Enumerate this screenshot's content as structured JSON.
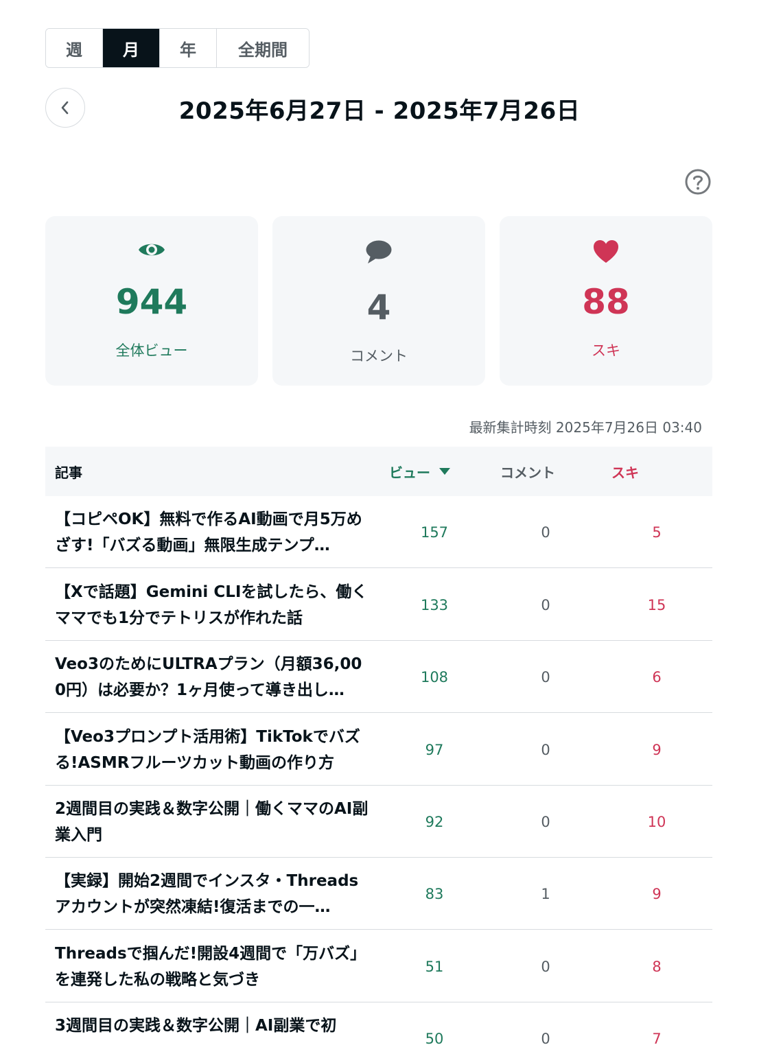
{
  "period_tabs": [
    "週",
    "月",
    "年",
    "全期間"
  ],
  "date_range": "2025年6月27日 - 2025年7月26日",
  "summary": {
    "views": {
      "value": "944",
      "label": "全体ビュー"
    },
    "comments": {
      "value": "4",
      "label": "コメント"
    },
    "likes": {
      "value": "88",
      "label": "スキ"
    }
  },
  "updated_at": "最新集計時刻 2025年7月26日 03:40",
  "table": {
    "headers": {
      "article": "記事",
      "views": "ビュー",
      "comments": "コメント",
      "likes": "スキ"
    },
    "rows": [
      {
        "title": "【コピペOK】無料で作るAI動画で月5万めざす!「バズる動画」無限生成テンプ…",
        "views": "157",
        "comments": "0",
        "likes": "5"
      },
      {
        "title": "【Xで話題】Gemini CLIを試したら、働くママでも1分でテトリスが作れた話",
        "views": "133",
        "comments": "0",
        "likes": "15"
      },
      {
        "title": "Veo3のためにULTRAプラン（月額36,000円）は必要か？1ヶ月使って導き出し…",
        "views": "108",
        "comments": "0",
        "likes": "6"
      },
      {
        "title": "【Veo3プロンプト活用術】TikTokでバズる!ASMRフルーツカット動画の作り方",
        "views": "97",
        "comments": "0",
        "likes": "9"
      },
      {
        "title": "2週間目の実践＆数字公開｜働くママのAI副業入門",
        "views": "92",
        "comments": "0",
        "likes": "10"
      },
      {
        "title": "【実録】開始2週間でインスタ・Threadsアカウントが突然凍結!復活までの一…",
        "views": "83",
        "comments": "1",
        "likes": "9"
      },
      {
        "title": "Threadsで掴んだ!開設4週間で「万バズ」を連発した私の戦略と気づき",
        "views": "51",
        "comments": "0",
        "likes": "8"
      },
      {
        "title": "3週間目の実践＆数字公開｜AI副業で初",
        "views": "50",
        "comments": "0",
        "likes": "7"
      }
    ]
  },
  "colors": {
    "views": "#1f7a5c",
    "comments": "#555d63",
    "likes": "#cf3556",
    "dark": "#08131a"
  }
}
